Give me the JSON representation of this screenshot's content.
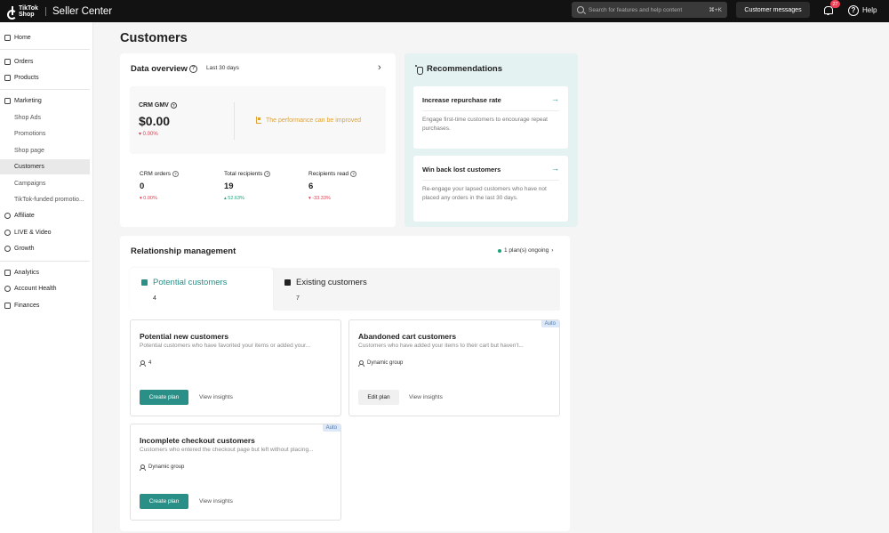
{
  "header": {
    "logo_text": "TikTok Shop",
    "app_title": "Seller Center",
    "search_placeholder": "Search for features and help content",
    "search_shortcut": "⌘+K",
    "customer_messages": "Customer messages",
    "notification_count": "27",
    "help_label": "Help",
    "help_glyph": "?"
  },
  "sidebar": {
    "home": "Home",
    "orders": "Orders",
    "products": "Products",
    "marketing": "Marketing",
    "shop_ads": "Shop Ads",
    "promotions": "Promotions",
    "shop_page": "Shop page",
    "customers": "Customers",
    "campaigns": "Campaigns",
    "tiktok_funded": "TikTok-funded promotio...",
    "affiliate": "Affiliate",
    "live_video": "LIVE & Video",
    "growth": "Growth",
    "analytics": "Analytics",
    "account_health": "Account Health",
    "finances": "Finances"
  },
  "page": {
    "title": "Customers"
  },
  "overview": {
    "title": "Data overview",
    "period": "Last 30 days",
    "arrow": "›",
    "q": "?",
    "gmv_label": "CRM GMV",
    "gmv_value": "$0.00",
    "gmv_change": "▾ 0.00%",
    "perf_note": "The performance can be improved",
    "metrics": [
      {
        "label": "CRM orders",
        "value": "0",
        "change": "▾ 0.00%"
      },
      {
        "label": "Total recipients",
        "value": "19",
        "change": "▴ 52.63%"
      },
      {
        "label": "Recipients read",
        "value": "6",
        "change": "▾ -33.33%"
      }
    ]
  },
  "recommendations": {
    "title": "Recommendations",
    "items": [
      {
        "title": "Increase repurchase rate",
        "arrow": "→",
        "desc": "Engage first-time customers to encourage repeat purchases."
      },
      {
        "title": "Win back lost customers",
        "arrow": "→",
        "desc": "Re-engage your lapsed customers who have not placed any orders in the last 30 days."
      }
    ]
  },
  "relationship": {
    "title": "Relationship management",
    "ongoing": "1 plan(s) ongoing",
    "ongoing_arrow": "›",
    "tabs": [
      {
        "label": "Potential customers",
        "count": "4"
      },
      {
        "label": "Existing customers",
        "count": "7"
      }
    ],
    "cards": [
      {
        "title": "Potential new customers",
        "desc": "Potential customers who have favorited your items or added your...",
        "meta": "4",
        "primary": "Create plan",
        "link": "View insights"
      },
      {
        "title": "Abandoned cart customers",
        "desc": "Customers who have added your items to their cart but haven't...",
        "meta": "Dynamic group",
        "primary": "Edit plan",
        "link": "View insights",
        "badge": "Auto"
      },
      {
        "title": "Incomplete checkout customers",
        "desc": "Customers who entered the checkout page but left without placing...",
        "meta": "Dynamic group",
        "primary": "Create plan",
        "link": "View insights",
        "badge": "Auto"
      }
    ]
  },
  "colors": {
    "accent": "#2a8f86",
    "negative": "#e2394e",
    "positive": "#1aa37a",
    "warning": "#e0a233",
    "topbar": "#121212"
  }
}
